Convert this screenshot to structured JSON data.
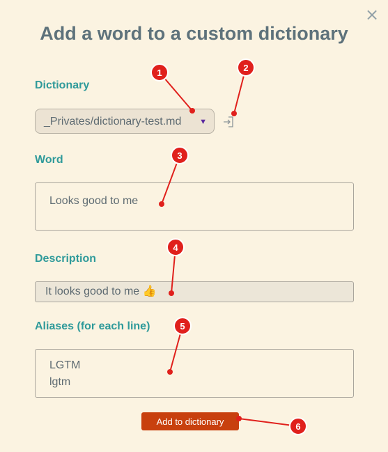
{
  "dialog": {
    "close_glyph": "×",
    "title": "Add a word to a custom dictionary"
  },
  "dictionary": {
    "label": "Dictionary",
    "selected": "_Privates/dictionary-test.md",
    "caret_glyph": "▼",
    "open_icon": "open-file-icon"
  },
  "word": {
    "label": "Word",
    "value": "Looks good to me"
  },
  "description": {
    "label": "Description",
    "value": "It looks good to me 👍"
  },
  "aliases": {
    "label": "Aliases (for each line)",
    "lines": [
      "LGTM",
      "lgtm"
    ]
  },
  "submit": {
    "label": "Add to dictionary"
  },
  "annotations": [
    "1",
    "2",
    "3",
    "4",
    "5",
    "6"
  ],
  "colors": {
    "background": "#fbf3e1",
    "label": "#2f9a9a",
    "title": "#5e727b",
    "button": "#c8400e",
    "annotation": "#e0201c"
  }
}
